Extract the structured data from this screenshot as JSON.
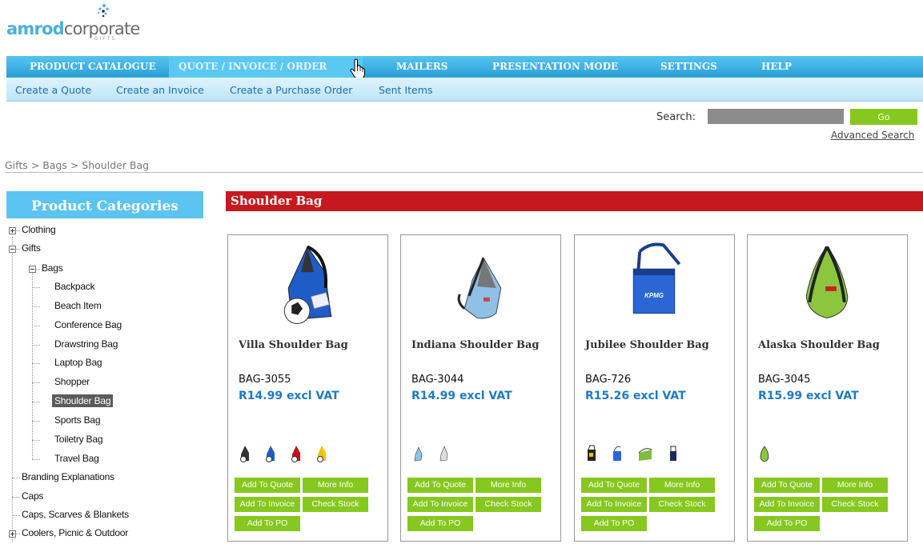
{
  "logo": {
    "amrod": "amrod",
    "corporate": "corporate",
    "gifts": "GIFTS"
  },
  "topnav": [
    {
      "label": "PRODUCT CATALOGUE"
    },
    {
      "label": "QUOTE / INVOICE / ORDER"
    },
    {
      "label": "MAILERS"
    },
    {
      "label": "PRESENTATION MODE"
    },
    {
      "label": "SETTINGS"
    },
    {
      "label": "HELP"
    }
  ],
  "subnav": [
    {
      "label": "Create a Quote"
    },
    {
      "label": "Create an Invoice"
    },
    {
      "label": "Create a Purchase Order"
    },
    {
      "label": "Sent Items"
    }
  ],
  "search": {
    "label": "Search:",
    "value": "",
    "go_label": "Go",
    "advanced_label": "Advanced Search"
  },
  "breadcrumb": {
    "gifts": "Gifts",
    "sep1": " > ",
    "bags": "Bags",
    "sep2": " > ",
    "current": "Shoulder Bag"
  },
  "sidebar": {
    "title": "Product Categories",
    "items": [
      {
        "label": "Clothing"
      },
      {
        "label": "Gifts"
      },
      {
        "label": "Bags"
      },
      {
        "label": "Backpack"
      },
      {
        "label": "Beach Item"
      },
      {
        "label": "Conference Bag"
      },
      {
        "label": "Drawstring Bag"
      },
      {
        "label": "Laptop Bag"
      },
      {
        "label": "Shopper"
      },
      {
        "label": "Shoulder Bag"
      },
      {
        "label": "Sports Bag"
      },
      {
        "label": "Toiletry Bag"
      },
      {
        "label": "Travel Bag"
      },
      {
        "label": "Branding Explanations"
      },
      {
        "label": "Caps"
      },
      {
        "label": "Caps, Scarves & Blankets"
      },
      {
        "label": "Coolers, Picnic & Outdoor"
      }
    ]
  },
  "main": {
    "title": "Shoulder Bag",
    "buttons": {
      "add_quote": "Add To Quote",
      "more_info": "More Info",
      "add_invoice": "Add To Invoice",
      "check_stock": "Check Stock",
      "add_po": "Add To PO"
    },
    "products": [
      {
        "name": "Villa Shoulder Bag",
        "code": "BAG-3055",
        "price": "R14.99 excl VAT"
      },
      {
        "name": "Indiana Shoulder Bag",
        "code": "BAG-3044",
        "price": "R14.99 excl VAT"
      },
      {
        "name": "Jubilee Shoulder Bag",
        "code": "BAG-726",
        "price": "R15.26 excl VAT",
        "print": "KPMG"
      },
      {
        "name": "Alaska Shoulder Bag",
        "code": "BAG-3045",
        "price": "R15.99 excl VAT"
      }
    ]
  },
  "colors": {
    "nav": "#2a9fd6",
    "subnav": "#bfe6f8",
    "header_red": "#c6191f",
    "button_green": "#86c81f",
    "price_blue": "#1f79c4"
  }
}
